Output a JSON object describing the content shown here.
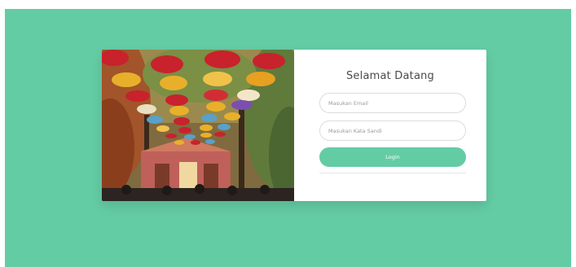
{
  "colors": {
    "background": "#64cca5",
    "accent": "#64cca5",
    "card": "#ffffff"
  },
  "login": {
    "title": "Selamat Datang",
    "email_placeholder": "Masukan Email",
    "password_placeholder": "Masukan Kata Sandi",
    "login_label": "Login"
  }
}
